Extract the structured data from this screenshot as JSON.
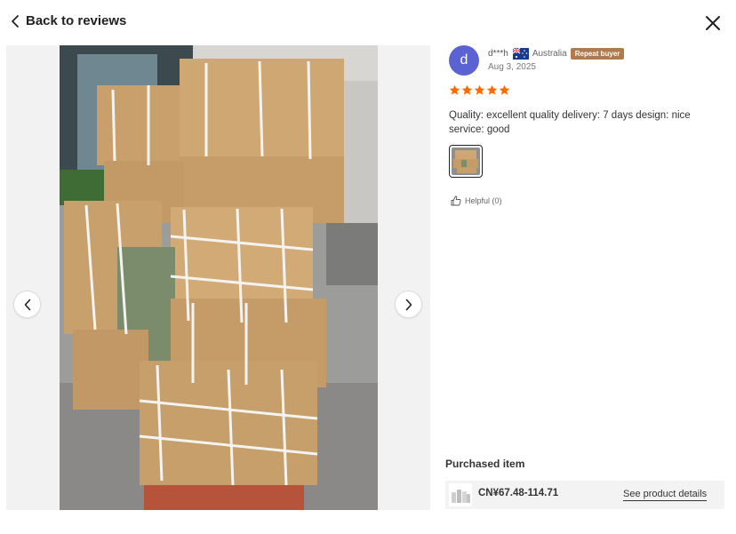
{
  "header": {
    "back_label": "Back to reviews",
    "back_icon": "chevron-left-icon",
    "close_icon": "close-icon"
  },
  "viewer": {
    "prev_icon": "chevron-left-icon",
    "next_icon": "chevron-right-icon"
  },
  "review": {
    "avatar_letter": "d",
    "avatar_color": "#5b63d3",
    "username": "d***h",
    "flag_icon": "australia-flag-icon",
    "country": "Australia",
    "badge": "Repeat buyer",
    "badge_color": "#b07a4f",
    "date": "Aug 3, 2025",
    "rating": 5,
    "star_color": "#ff6a00",
    "text": "Quality: excellent quality delivery: 7 days design: nice service: good",
    "helpful_label": "Helpful (0)"
  },
  "purchased": {
    "title": "Purchased item",
    "price": "CN¥67.48-114.71",
    "link_label": "See product details"
  }
}
